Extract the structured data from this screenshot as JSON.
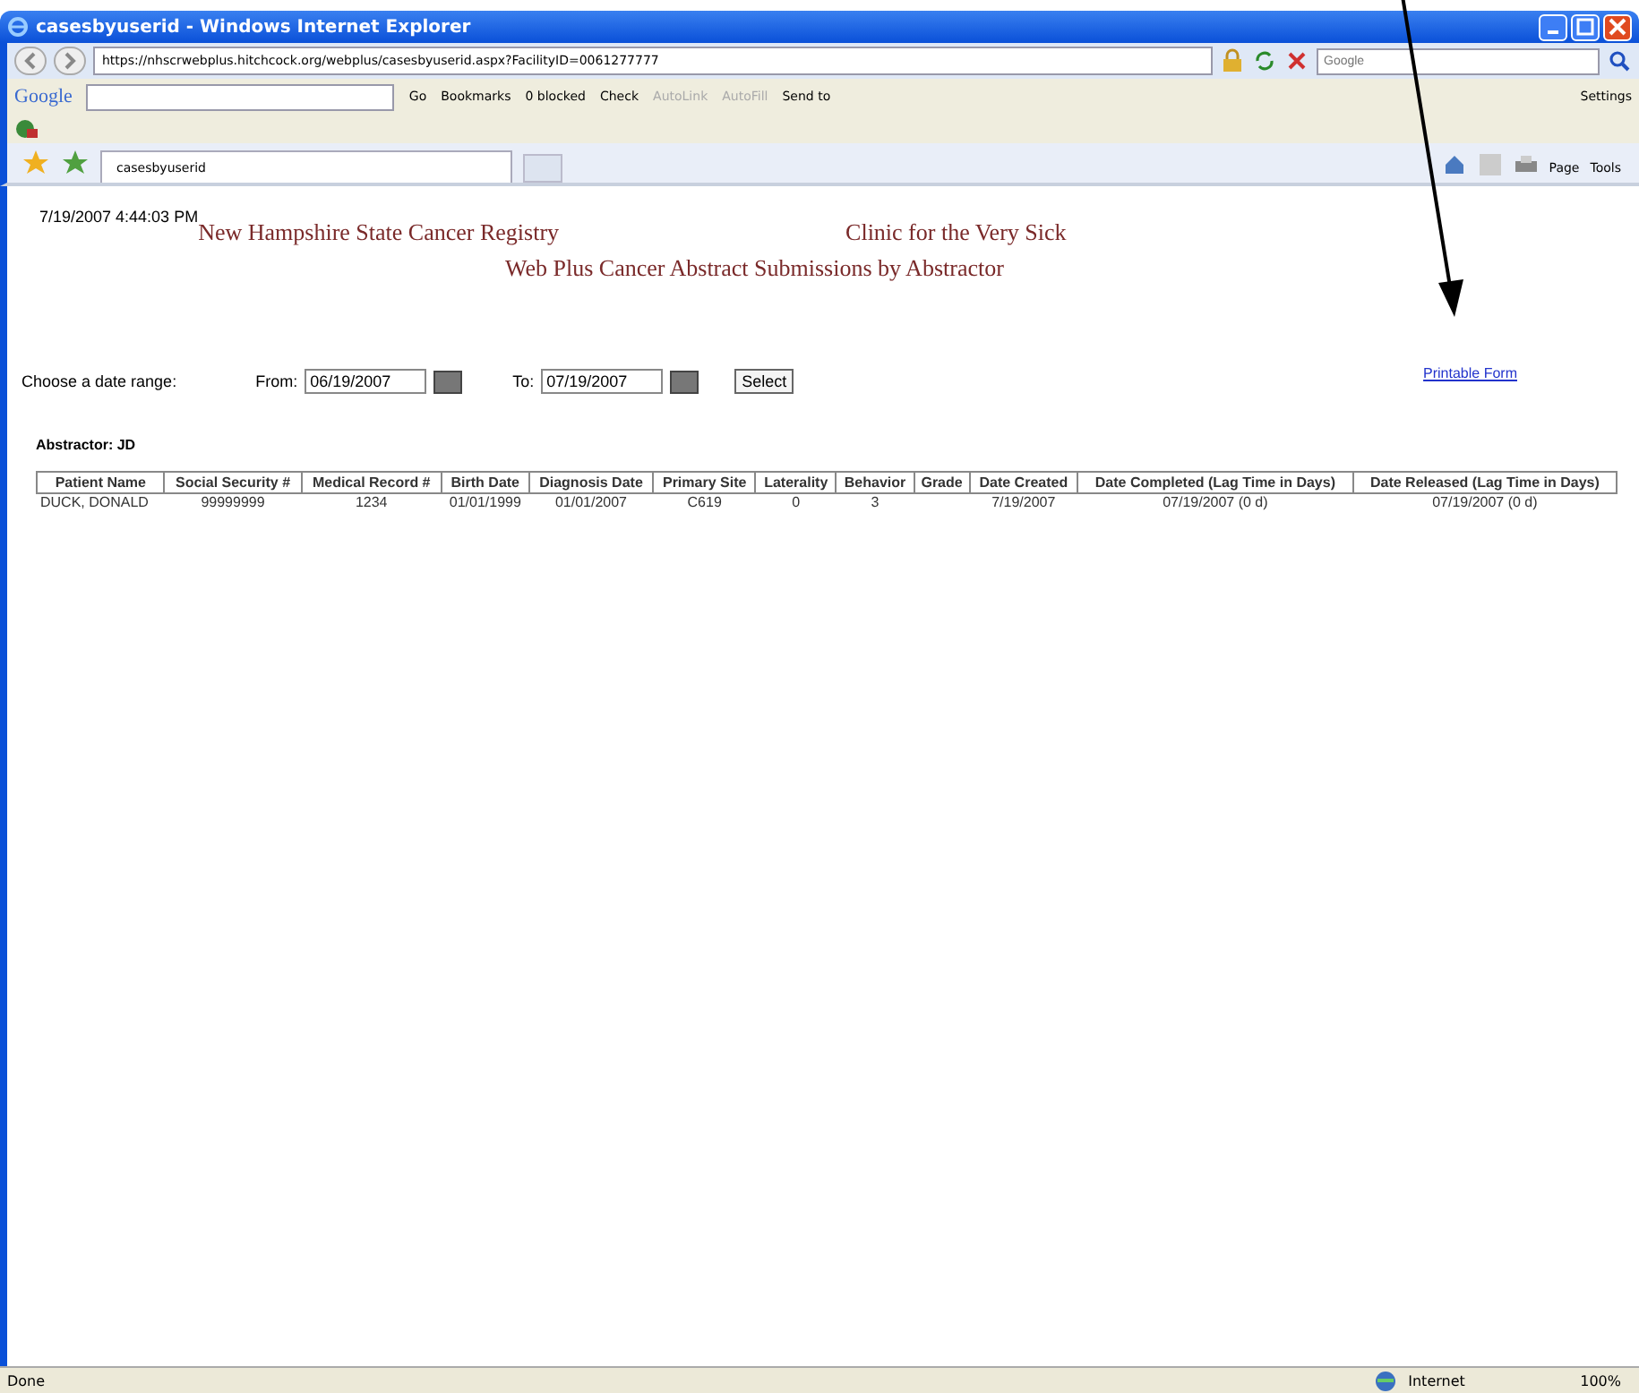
{
  "window": {
    "title": "casesbyuserid - Windows Internet Explorer"
  },
  "address_bar": {
    "url": "https://nhscrwebplus.hitchcock.org/webplus/casesbyuserid.aspx?FacilityID=0061277777",
    "search_placeholder": "Google"
  },
  "google_toolbar": {
    "logo": "Google",
    "items": [
      {
        "label": "Go",
        "disabled": false
      },
      {
        "label": "Bookmarks",
        "disabled": false
      },
      {
        "label": "0 blocked",
        "disabled": false
      },
      {
        "label": "Check",
        "disabled": false
      },
      {
        "label": "AutoLink",
        "disabled": true
      },
      {
        "label": "AutoFill",
        "disabled": true
      },
      {
        "label": "Send to",
        "disabled": false
      }
    ],
    "settings": "Settings"
  },
  "tabs": [
    {
      "label": "casesbyuserid",
      "selected": true
    }
  ],
  "command_bar": [
    "Page",
    "Tools"
  ],
  "page": {
    "timestamp": "7/19/2007 4:44:03 PM",
    "registry": "New Hampshire State Cancer Registry",
    "clinic": "Clinic for the Very Sick",
    "subtitle": "Web Plus Cancer Abstract Submissions by Abstractor",
    "date_range_label": "Choose a date range:",
    "from_label": "From:",
    "from_value": "06/19/2007",
    "to_label": "To:",
    "to_value": "07/19/2007",
    "select_button": "Select",
    "printable_link": "Printable Form",
    "abstractor": "Abstractor: JD",
    "table": {
      "columns": [
        "Patient Name",
        "Social Security #",
        "Medical Record #",
        "Birth Date",
        "Diagnosis Date",
        "Primary Site",
        "Laterality",
        "Behavior",
        "Grade",
        "Date Created",
        "Date Completed (Lag Time in Days)",
        "Date Released (Lag Time in Days)"
      ],
      "rows": [
        [
          "DUCK, DONALD",
          "99999999",
          "1234",
          "01/01/1999",
          "01/01/2007",
          "C619",
          "0",
          "3",
          "",
          "7/19/2007",
          "07/19/2007 (0 d)",
          "07/19/2007 (0 d)"
        ]
      ]
    }
  },
  "status_bar": {
    "text": "Done",
    "zone": "Internet",
    "zoom": "100%"
  }
}
